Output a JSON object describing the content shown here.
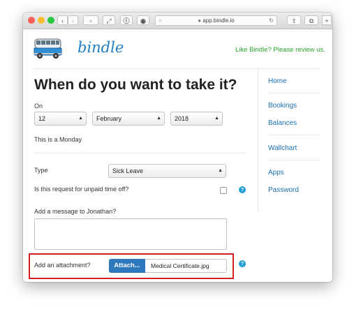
{
  "browser": {
    "url": "app.bindle.io"
  },
  "header": {
    "logo_text": "bindle",
    "review_link": "Like Bindle? Please review us."
  },
  "form": {
    "title": "When do you want to take it?",
    "on_label": "On",
    "day_value": "12",
    "month_value": "February",
    "year_value": "2018",
    "weekday_text": "This is a Monday",
    "type_label": "Type",
    "type_value": "Sick Leave",
    "unpaid_label": "Is this request for unpaid time off?",
    "message_label": "Add a message to Jonathan?",
    "attachment_label": "Add an attachment?",
    "attach_button": "Attach...",
    "attached_file": "Medical Certificate.jpg"
  },
  "sidebar": {
    "items": [
      {
        "label": "Home"
      },
      {
        "label": "Bookings"
      },
      {
        "label": "Balances"
      },
      {
        "label": "Wallchart"
      },
      {
        "label": "Apps"
      },
      {
        "label": "Password"
      }
    ]
  },
  "colors": {
    "brand_blue": "#1f7fc2",
    "review_green": "#2aa52a",
    "attach_blue": "#2e79bd",
    "highlight_red": "#d21f1f"
  }
}
